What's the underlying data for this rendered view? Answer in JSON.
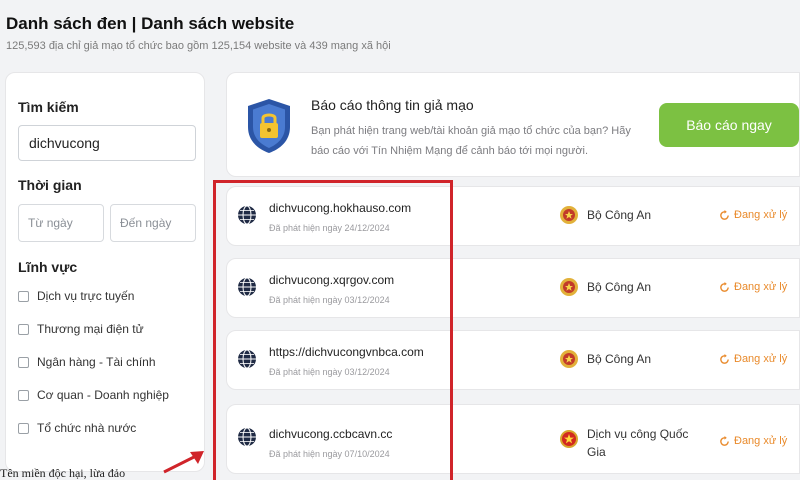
{
  "header": {
    "title": "Danh sách đen | Danh sách website",
    "subtitle": "125,593 địa chỉ giả mạo tổ chức bao gồm 125,154 website và 439 mạng xã hội"
  },
  "sidebar": {
    "search_label": "Tìm kiếm",
    "search_value": "dichvucong",
    "time_label": "Thời gian",
    "from_placeholder": "Từ ngày",
    "to_placeholder": "Đến ngày",
    "field_label": "Lĩnh vực",
    "fields": [
      "Dịch vụ trực tuyến",
      "Thương mại điện tử",
      "Ngân hàng - Tài chính",
      "Cơ quan - Doanh nghiệp",
      "Tổ chức nhà nước"
    ]
  },
  "report": {
    "title": "Báo cáo thông tin giả mạo",
    "description": "Bạn phát hiện trang web/tài khoản giả mạo tổ chức của bạn? Hãy báo cáo với Tín Nhiệm Mạng để cảnh báo tới mọi người.",
    "button_label": "Báo cáo ngay"
  },
  "results": [
    {
      "domain": "dichvucong.hokhauso.com",
      "detected": "Đã phát hiện ngày 24/12/2024",
      "org": "Bộ Công An",
      "status": "Đang xử lý"
    },
    {
      "domain": "dichvucong.xqrgov.com",
      "detected": "Đã phát hiện ngày 03/12/2024",
      "org": "Bộ Công An",
      "status": "Đang xử lý"
    },
    {
      "domain": "https://dichvucongvnbca.com",
      "detected": "Đã phát hiện ngày 03/12/2024",
      "org": "Bộ Công An",
      "status": "Đang xử lý"
    },
    {
      "domain": "dichvucong.ccbcavn.cc",
      "detected": "Đã phát hiện ngày 07/10/2024",
      "org": "Dịch vụ công Quốc Gia",
      "status": "Đang xử lý"
    }
  ],
  "annotation": {
    "text": "Tên miền độc hại, lừa đảo"
  },
  "colors": {
    "accent_green": "#7cc142",
    "status_orange": "#e98a2b",
    "highlight_red": "#d0242a"
  }
}
